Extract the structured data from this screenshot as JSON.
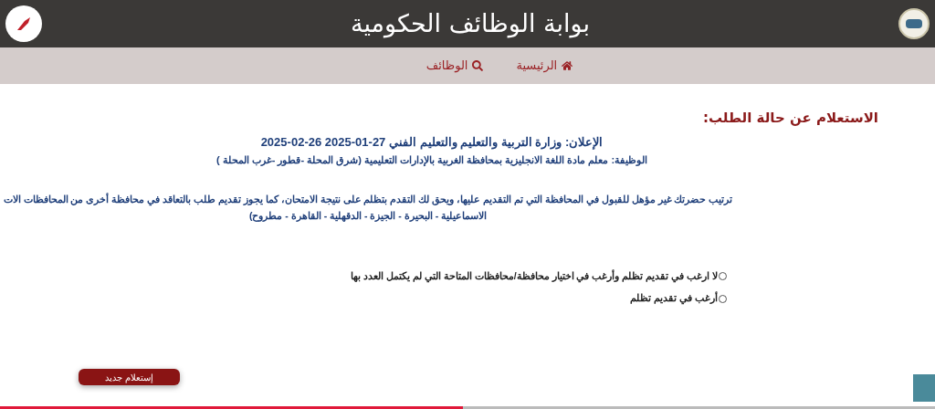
{
  "header": {
    "title": "بوابة الوظائف الحكومية"
  },
  "nav": [
    {
      "label": "الرئيسية",
      "kind": "home"
    },
    {
      "label": "الوظائف",
      "kind": "search"
    }
  ],
  "heading": "الاستعلام عن حالة الطلب:",
  "announcement": "الإعلان: وزارة التربية والتعليم والتعليم الفني 27-01-2025 26-02-2025",
  "job": "الوظيفة: معلم مادة اللغة الانجليزية بمحافظة الغربية بالإدارات التعليمية (شرق المحلة -قطور -غرب المحلة )",
  "result_lines": [
    "ترتيب حضرتك غير مؤهل للقبول في المحافظة التي تم التقديم عليها، ويحق لك التقدم بتظلم على نتيجة الامتحان، كما يجوز تقديم طلب بالتعاقد في محافظة أخرى من المحافظات الات",
    "الاسماعيلية - البحيرة - الجيزة - الدقهلية - القاهرة - مطروح)"
  ],
  "options": [
    {
      "label": "لا ارغب في تقديم تظلم وأرغب في اختيار محافظة/محافظات المتاحة التي لم يكتمل العدد بها",
      "selected": false
    },
    {
      "label": "أرغب في تقديم تظلم",
      "selected": false
    }
  ],
  "new_query_button": "إستعلام جديد",
  "player": {
    "level": 0.495
  }
}
